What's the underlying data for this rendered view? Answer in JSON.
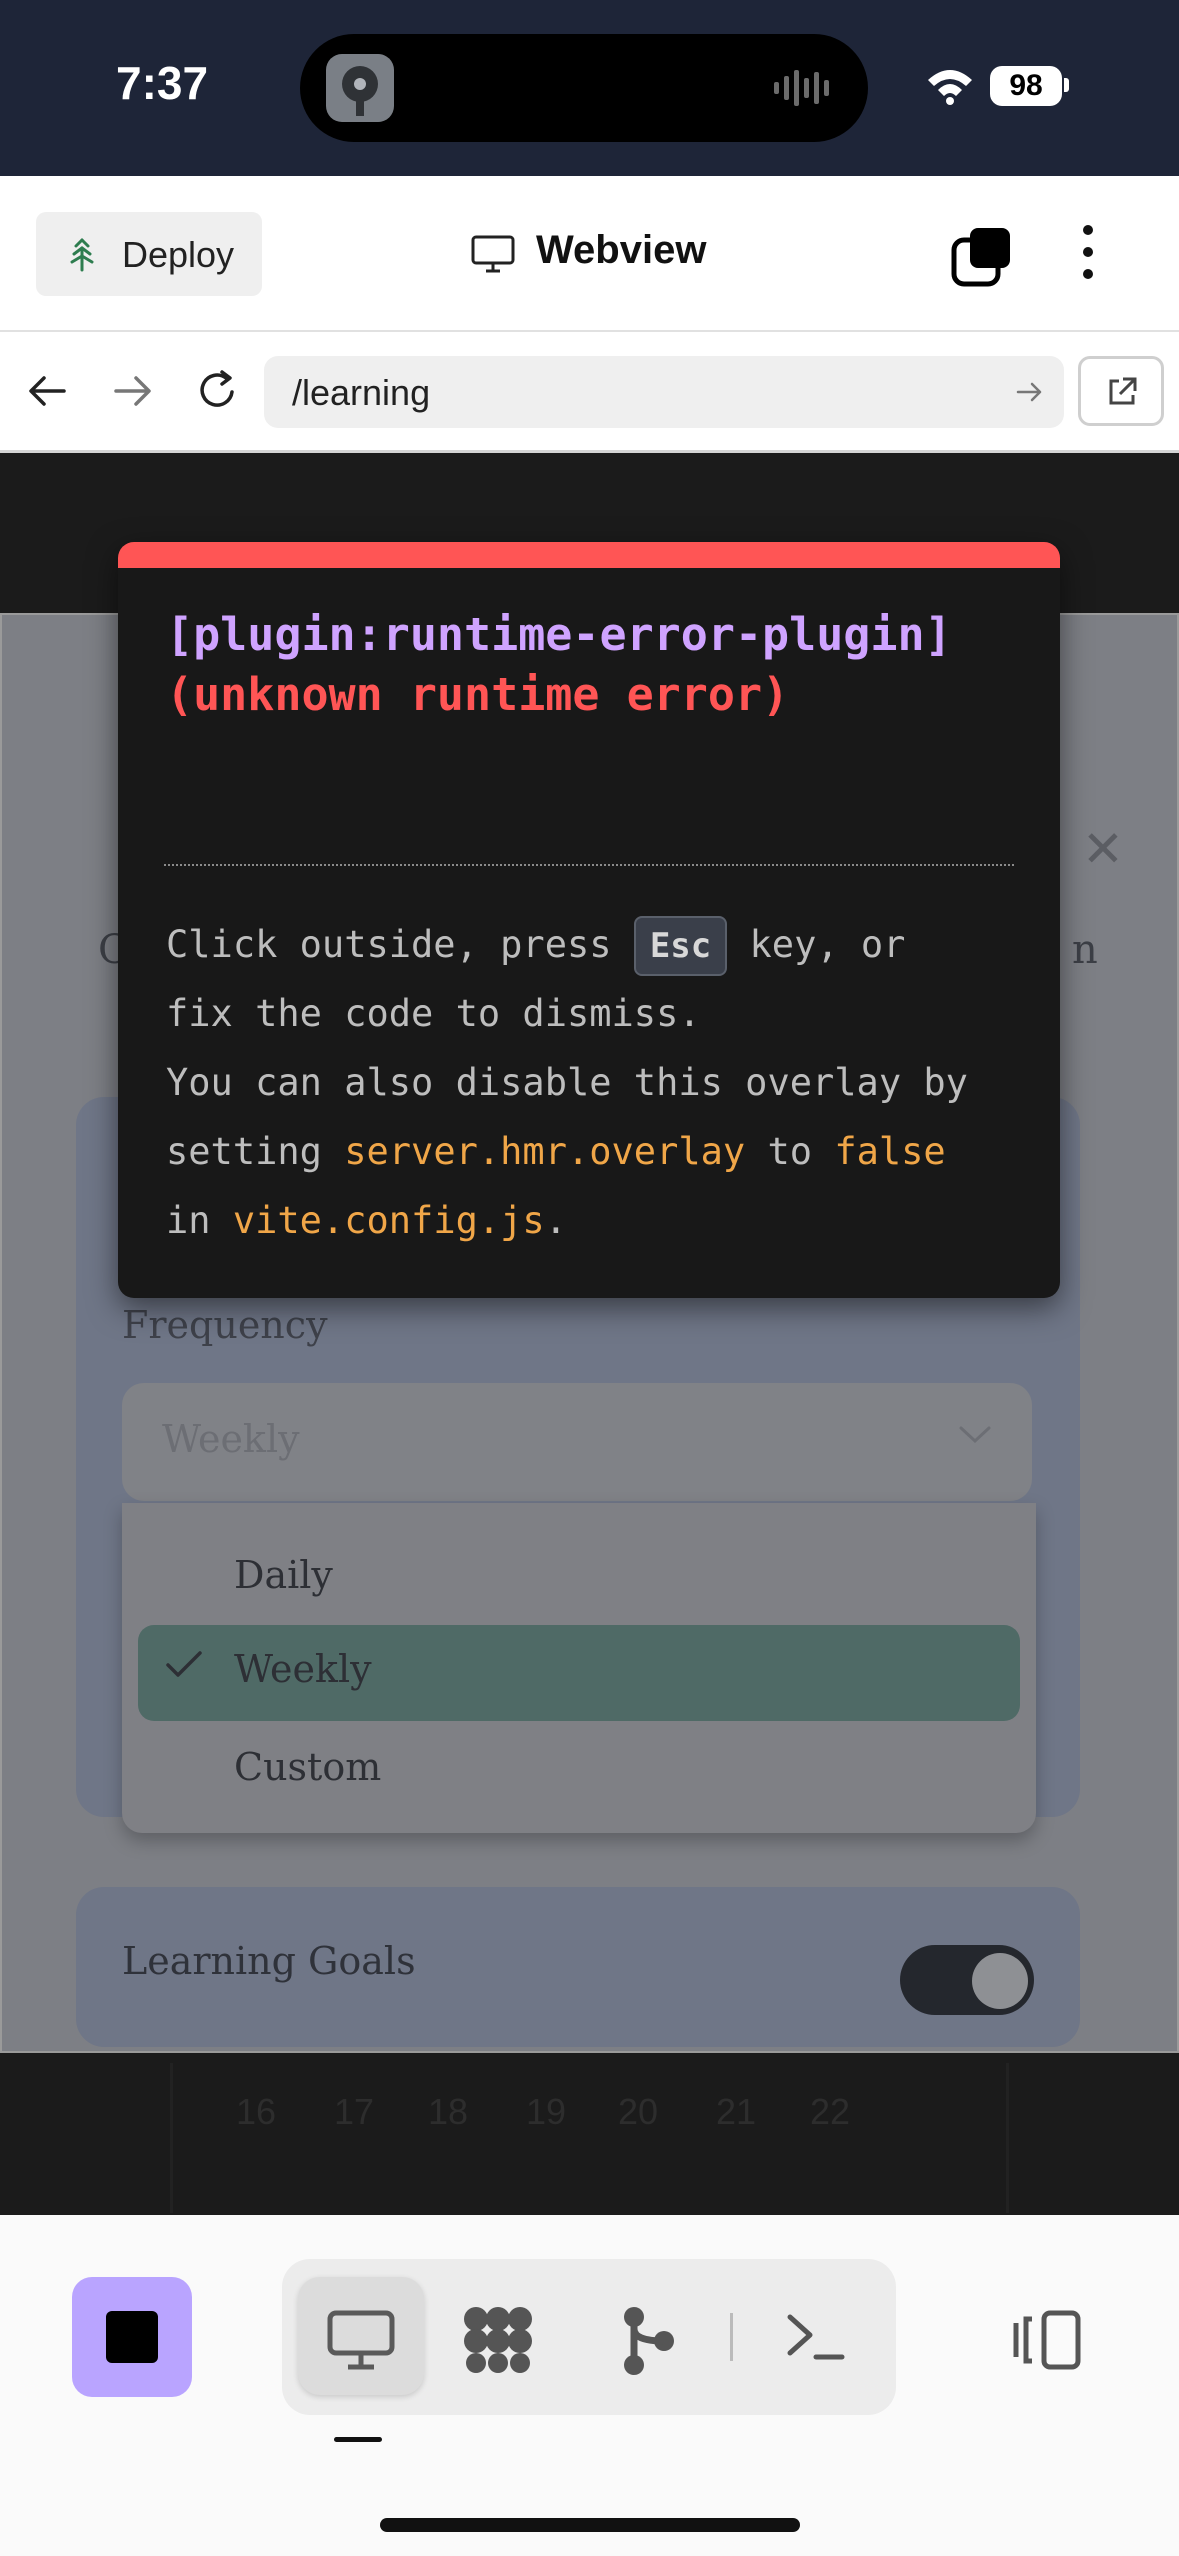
{
  "status_bar": {
    "time": "7:37",
    "battery": "98"
  },
  "toolbar": {
    "deploy_label": "Deploy",
    "title": "Webview"
  },
  "url_bar": {
    "url": "/learning"
  },
  "page_behind": {
    "frequency_label": "Frequency",
    "frequency_value": "Weekly",
    "options": [
      {
        "label": "Daily",
        "selected": false
      },
      {
        "label": "Weekly",
        "selected": true
      },
      {
        "label": "Custom",
        "selected": false
      }
    ],
    "goals_label": "Learning Goals",
    "goals_enabled": true,
    "calendar_days": [
      "16",
      "17",
      "18",
      "19",
      "20",
      "21",
      "22"
    ]
  },
  "error_overlay": {
    "plugin": "[plugin:runtime-error-plugin]",
    "message": "(unknown runtime error)",
    "tip_click": "Click outside, press",
    "tip_key": "Esc",
    "tip_key_suffix": "key, or",
    "tip_fix": "fix the code to dismiss.",
    "tip_disable": "You can also disable this overlay by",
    "tip_setting": "setting",
    "tip_setting_code": "server.hmr.overlay",
    "tip_to": "to",
    "tip_false": "false",
    "tip_in": "in",
    "tip_config": "vite.config.js",
    "tip_period": "."
  },
  "bottom_bar": {
    "tabs": [
      "preview-icon",
      "puzzle-icon",
      "git-icon",
      "shell-icon"
    ],
    "accent": "#b9a4ff"
  }
}
